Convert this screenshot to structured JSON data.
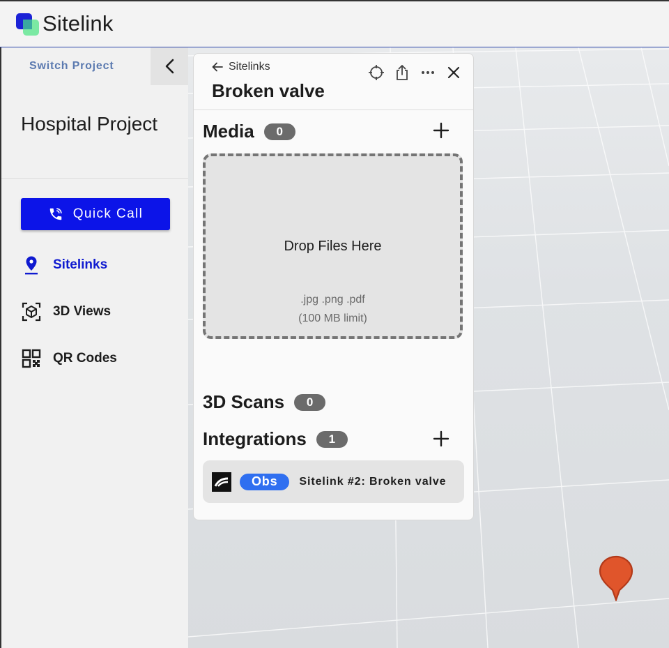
{
  "app": {
    "name": "Sitelink"
  },
  "sidebar": {
    "switch_project": "Switch Project",
    "project_name": "Hospital Project",
    "quick_call": "Quick Call",
    "nav": [
      {
        "label": "Sitelinks",
        "icon": "location-pin-icon",
        "active": true
      },
      {
        "label": "3D Views",
        "icon": "3d-cube-icon",
        "active": false
      },
      {
        "label": "QR Codes",
        "icon": "qr-code-icon",
        "active": false
      }
    ]
  },
  "panel": {
    "back_label": "Sitelinks",
    "title": "Broken valve",
    "actions": [
      "crosshair-icon",
      "share-icon",
      "more-icon",
      "close-icon"
    ],
    "media": {
      "title": "Media",
      "count": "0"
    },
    "dropzone": {
      "text": "Drop Files Here",
      "types": ".jpg .png .pdf",
      "limit": "(100 MB limit)"
    },
    "scans": {
      "title": "3D Scans",
      "count": "0"
    },
    "integrations": {
      "title": "Integrations",
      "count": "1",
      "items": [
        {
          "tag": "Obs",
          "label": "Sitelink #2: Broken valve"
        }
      ]
    }
  },
  "colors": {
    "primary": "#0c14e8",
    "active_nav": "#0f1ad0",
    "obs_tag": "#2f6ff0",
    "pin": "#e0552b",
    "badge": "#6b6b6b"
  }
}
